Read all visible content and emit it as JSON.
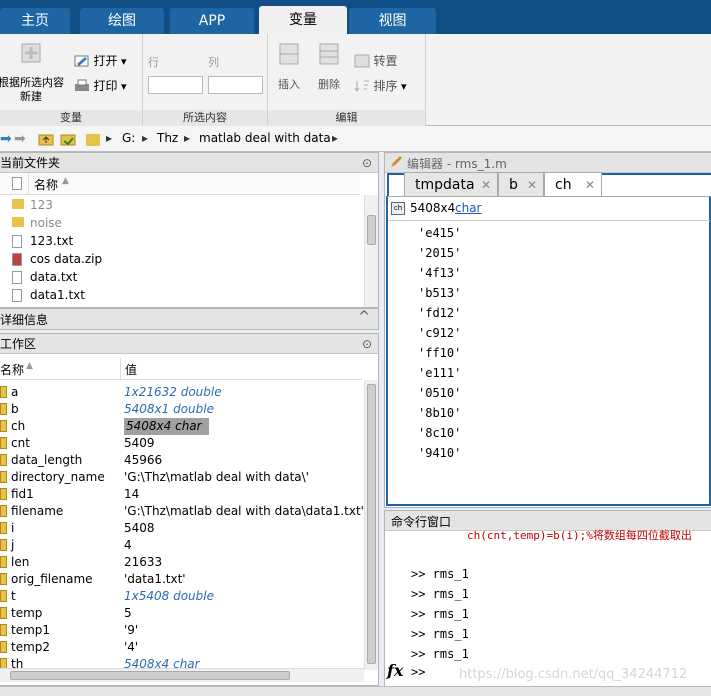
{
  "tabs": [
    "主页",
    "绘图",
    "APP",
    "变量",
    "视图"
  ],
  "ribbon": {
    "new_from_selection": "根据所选内容\n新建",
    "open": "打开",
    "print": "打印",
    "row_label": "行",
    "col_label": "列",
    "insert": "插入",
    "delete": "删除",
    "transpose": "转置",
    "sort": "排序",
    "group_variable": "变量",
    "group_selection": "所选内容",
    "group_edit": "编辑"
  },
  "path": [
    "G:",
    "Thz",
    "matlab deal with data"
  ],
  "current_folder": {
    "title": "当前文件夹",
    "col_name": "名称",
    "items": [
      {
        "name": "123",
        "type": "folder",
        "dim": true
      },
      {
        "name": "noise",
        "type": "folder",
        "dim": true
      },
      {
        "name": "123.txt",
        "type": "file"
      },
      {
        "name": "cos data.zip",
        "type": "zip"
      },
      {
        "name": "data.txt",
        "type": "file"
      },
      {
        "name": "data1.txt",
        "type": "file"
      }
    ]
  },
  "details_title": "详细信息",
  "workspace": {
    "title": "工作区",
    "col_name": "名称",
    "col_value": "值",
    "rows": [
      {
        "name": "a",
        "value": "1x21632 double",
        "ital": true
      },
      {
        "name": "b",
        "value": "5408x1 double",
        "ital": true
      },
      {
        "name": "ch",
        "value": "5408x4 char",
        "ital": true,
        "selected": true
      },
      {
        "name": "cnt",
        "value": "5409"
      },
      {
        "name": "data_length",
        "value": "45966"
      },
      {
        "name": "directory_name",
        "value": "'G:\\Thz\\matlab deal with data\\'"
      },
      {
        "name": "fid1",
        "value": "14"
      },
      {
        "name": "filename",
        "value": "'G:\\Thz\\matlab deal with data\\data1.txt'"
      },
      {
        "name": "i",
        "value": "5408"
      },
      {
        "name": "j",
        "value": "4"
      },
      {
        "name": "len",
        "value": "21633"
      },
      {
        "name": "orig_filename",
        "value": "'data1.txt'"
      },
      {
        "name": "t",
        "value": "1x5408 double",
        "ital": true
      },
      {
        "name": "temp",
        "value": "5"
      },
      {
        "name": "temp1",
        "value": "'9'"
      },
      {
        "name": "temp2",
        "value": "'4'"
      },
      {
        "name": "th",
        "value": "5408x4 char",
        "ital": true
      }
    ]
  },
  "editor": {
    "title": "编辑器 - rms_1.m",
    "tabs": [
      "tmpdata",
      "b",
      "ch"
    ],
    "info_size": "5408x4",
    "info_type": "char",
    "values": [
      "'e415'",
      "'2015'",
      "'4f13'",
      "'b513'",
      "'fd12'",
      "'c912'",
      "'ff10'",
      "'e111'",
      "'0510'",
      "'8b10'",
      "'8c10'",
      "'9410'"
    ]
  },
  "command": {
    "title": "命令行窗口",
    "partial": "ch(cnt,temp)=b(i);%将数组每四位截取出",
    "lines": [
      ">> rms_1",
      ">> rms_1",
      ">> rms_1",
      ">> rms_1",
      ">> rms_1"
    ],
    "prompt": ">>",
    "fx": "fx"
  },
  "watermark": "https://blog.csdn.net/qq_34244712"
}
